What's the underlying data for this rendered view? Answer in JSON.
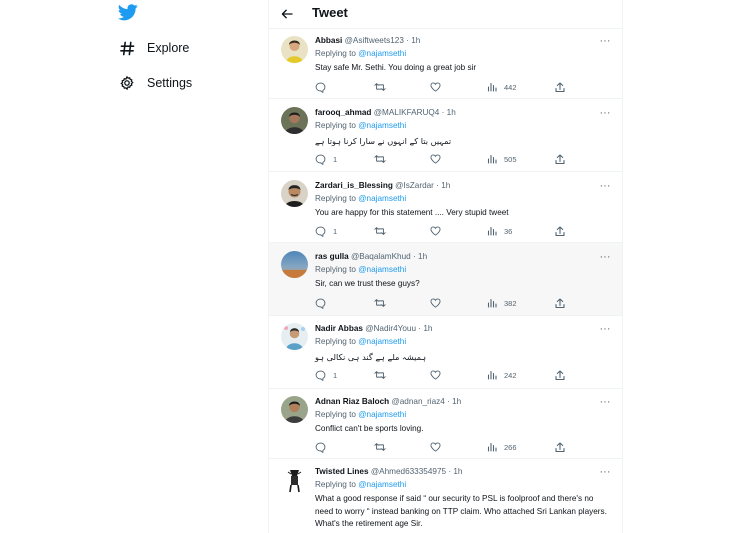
{
  "nav": {
    "items": [
      {
        "label": "Explore",
        "icon": "hashtag-icon"
      },
      {
        "label": "Settings",
        "icon": "gear-icon"
      }
    ]
  },
  "header": {
    "title": "Tweet"
  },
  "colors": {
    "accent": "#1d9bf0",
    "text": "#0f1419",
    "muted": "#536471"
  },
  "tweets": [
    {
      "name": "Abbasi",
      "handle": "@Asiftweets123",
      "time": "1h",
      "reply_prefix": "Replying to",
      "mention": "@najamsethi",
      "text": "Stay safe Mr. Sethi. You doing a great job sir",
      "replies": "",
      "views": "442"
    },
    {
      "name": "farooq_ahmad",
      "handle": "@MALIKFARUQ4",
      "time": "1h",
      "reply_prefix": "Replying to",
      "mention": "@najamsethi",
      "text": "تمہیں بتا کے انہوں نے سارا کرنا ہوتا ہے",
      "replies": "1",
      "views": "505"
    },
    {
      "name": "Zardari_is_Blessing",
      "handle": "@IsZardar",
      "time": "1h",
      "reply_prefix": "Replying to",
      "mention": "@najamsethi",
      "text": "You are happy for this statement .... Very stupid tweet",
      "replies": "1",
      "views": "36"
    },
    {
      "name": "ras gulla",
      "handle": "@BaqalamKhud",
      "time": "1h",
      "reply_prefix": "Replying to",
      "mention": "@najamsethi",
      "text": "Sir, can we trust these guys?",
      "replies": "",
      "views": "382"
    },
    {
      "name": "Nadir Abbas",
      "handle": "@Nadir4Youu",
      "time": "1h",
      "reply_prefix": "Replying to",
      "mention": "@najamsethi",
      "text": "ہمیشہ ملے ہے گند ہی نکالی ہو",
      "replies": "1",
      "views": "242"
    },
    {
      "name": "Adnan Riaz Baloch",
      "handle": "@adnan_riaz4",
      "time": "1h",
      "reply_prefix": "Replying to",
      "mention": "@najamsethi",
      "text": "Conflict can't be sports loving.",
      "replies": "",
      "views": "266"
    },
    {
      "name": "Twisted Lines",
      "handle": "@Ahmed633354975",
      "time": "1h",
      "reply_prefix": "Replying to",
      "mention": "@najamsethi",
      "text": "What a good response if said “ our security to PSL is foolproof and there's no need to worry “ instead banking on TTP claim. Who attached Sri Lankan players. What's the retirement age Sir.",
      "replies": "",
      "views": ""
    }
  ]
}
